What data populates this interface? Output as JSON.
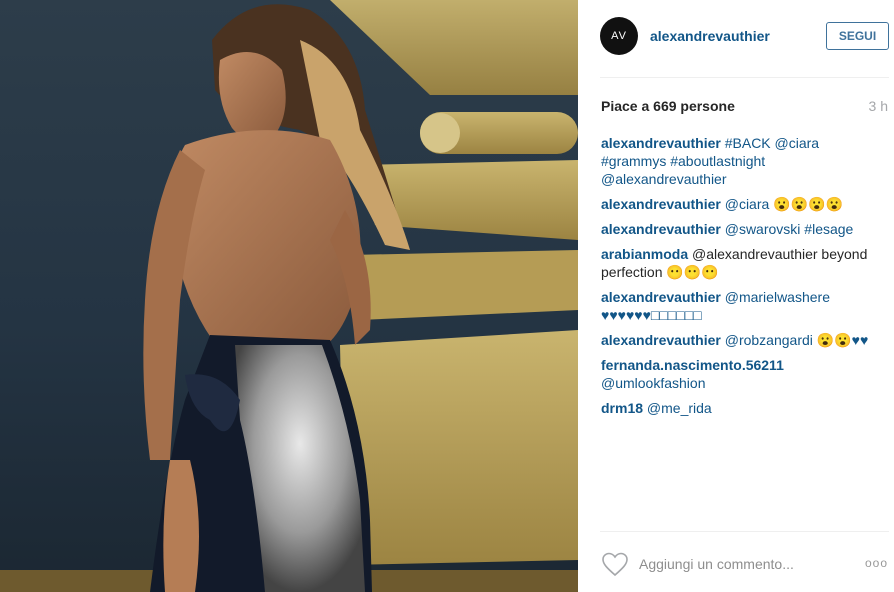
{
  "post": {
    "avatar_text": "AV",
    "username": "alexandrevauthier",
    "follow_label": "SEGUI",
    "likes": "Piace a 669 persone",
    "time": "3 h"
  },
  "comments": [
    {
      "author": "alexandrevauthier",
      "text": "#BACK @ciara #grammys #aboutlastnight @alexandrevauthier",
      "is_link": true
    },
    {
      "author": "alexandrevauthier",
      "text": "@ciara 😮😮😮😮",
      "is_link": true
    },
    {
      "author": "alexandrevauthier",
      "text": "@swarovski #lesage",
      "is_link": true
    },
    {
      "author": "arabianmoda",
      "text": "@alexandrevauthier beyond perfection 😶😶😶",
      "is_link": false
    },
    {
      "author": "alexandrevauthier",
      "text": "@marielwashere ♥♥♥♥♥♥□□□□□□",
      "is_link": true
    },
    {
      "author": "alexandrevauthier",
      "text": "@robzangardi 😮😮♥♥",
      "is_link": true
    },
    {
      "author": "fernanda.nascimento.56211",
      "text": "@umlookfashion",
      "is_link": true
    },
    {
      "author": "drm18",
      "text": "@me_rida",
      "is_link": true
    }
  ],
  "footer": {
    "add_comment_placeholder": "Aggiungi un commento...",
    "more_label": "ooo"
  },
  "colors": {
    "link": "#125688",
    "follow_border": "#3f729b",
    "background": "#ffffff"
  },
  "icons": [
    "heart-icon",
    "more-options-icon"
  ]
}
